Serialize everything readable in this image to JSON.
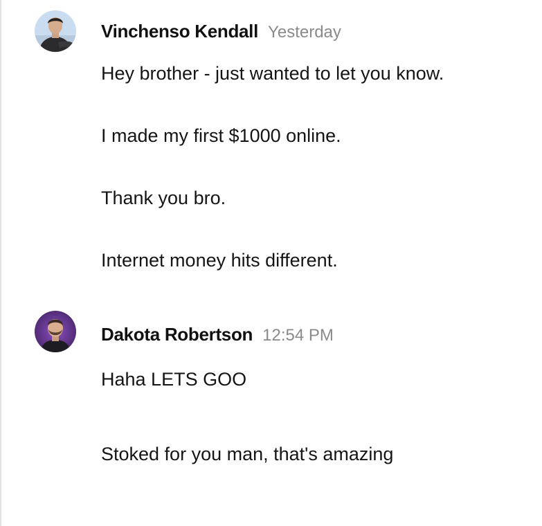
{
  "messages": [
    {
      "author": "Vinchenso Kendall",
      "timestamp": "Yesterday",
      "lines": [
        "Hey brother - just wanted to let you know.",
        "I made my first $1000 online.",
        "Thank you bro.",
        "Internet money hits different."
      ]
    },
    {
      "author": "Dakota Robertson",
      "timestamp": "12:54 PM",
      "lines": [
        "Haha LETS GOO",
        "Stoked for you man, that's amazing"
      ]
    }
  ],
  "colors": {
    "author": "#111111",
    "timestamp": "#8a8a8a",
    "text": "#151515",
    "rule": "#e3e3e3"
  }
}
